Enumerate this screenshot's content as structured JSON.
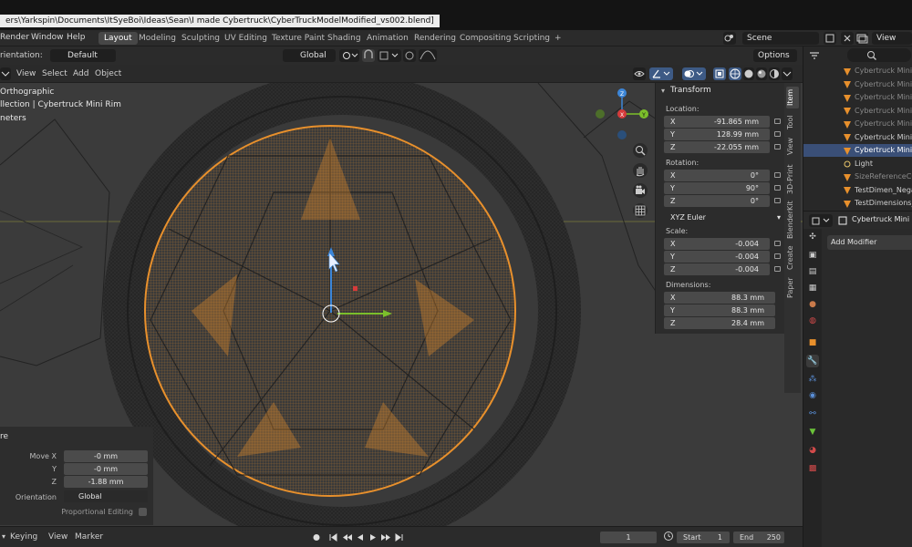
{
  "window": {
    "title": "ers\\Yarkspin\\Documents\\ItSyeBoi\\Ideas\\Sean\\I made  Cybertruck\\CyberTruckModelModified_vs002.blend]"
  },
  "menu": [
    "Render",
    "Window",
    "Help"
  ],
  "workspaces": {
    "tabs": [
      "Layout",
      "Modeling",
      "Sculpting",
      "UV Editing",
      "Texture Paint",
      "Shading",
      "Animation",
      "Rendering",
      "Compositing",
      "Scripting"
    ],
    "active": "Layout",
    "add": "+"
  },
  "scene": {
    "label": "Scene",
    "view_layer": "View Laye"
  },
  "header2": {
    "orientation_label": "rientation:",
    "orientation_value": "Default",
    "transform_orientation": "Global",
    "options_label": "Options"
  },
  "header3": {
    "menus": [
      "View",
      "Select",
      "Add",
      "Object"
    ]
  },
  "viewport": {
    "overlay": [
      "Orthographic",
      "llection | Cybertruck Mini Rim",
      "neters"
    ],
    "gizmo": {
      "x": "X",
      "y": "Y",
      "z": "Z"
    }
  },
  "npanel": {
    "tabs": [
      "Item",
      "Tool",
      "View",
      "3D-Print",
      "BlenderKit",
      "Create",
      "Paper"
    ],
    "active_tab": "Item",
    "section": "Transform",
    "location_label": "Location:",
    "location": [
      {
        "axis": "X",
        "value": "-91.865 mm"
      },
      {
        "axis": "Y",
        "value": "128.99 mm"
      },
      {
        "axis": "Z",
        "value": "-22.055 mm"
      }
    ],
    "rotation_label": "Rotation:",
    "rotation": [
      {
        "axis": "X",
        "value": "0°"
      },
      {
        "axis": "Y",
        "value": "90°"
      },
      {
        "axis": "Z",
        "value": "0°"
      }
    ],
    "rotation_mode": "XYZ Euler",
    "scale_label": "Scale:",
    "scale": [
      {
        "axis": "X",
        "value": "-0.004"
      },
      {
        "axis": "Y",
        "value": "-0.004"
      },
      {
        "axis": "Z",
        "value": "-0.004"
      }
    ],
    "dimensions_label": "Dimensions:",
    "dimensions": [
      {
        "axis": "X",
        "value": "88.3 mm"
      },
      {
        "axis": "Y",
        "value": "88.3 mm"
      },
      {
        "axis": "Z",
        "value": "28.4 mm"
      }
    ]
  },
  "redo_panel": {
    "title": "re",
    "fields": [
      {
        "label": "Move X",
        "value": "-0 mm"
      },
      {
        "label": "Y",
        "value": "-0 mm"
      },
      {
        "label": "Z",
        "value": "-1.88 mm"
      }
    ],
    "orientation_label": "Orientation",
    "orientation_value": "Global",
    "proportional_label": "Proportional Editing"
  },
  "timeline": {
    "menus": [
      "Keying",
      "View",
      "Marker"
    ],
    "current_frame": "1",
    "start_label": "Start",
    "start": "1",
    "end_label": "End",
    "end": "250"
  },
  "outliner": {
    "items": [
      {
        "name": "Cybertruck Mini R",
        "style": "dim"
      },
      {
        "name": "Cybertruck Mini F",
        "style": "dim"
      },
      {
        "name": "Cybertruck Mini F",
        "style": "dim"
      },
      {
        "name": "Cybertruck Mini F",
        "style": "dim"
      },
      {
        "name": "Cybertruck Mini F",
        "style": "dim"
      },
      {
        "name": "Cybertruck Mini F",
        "style": "normal"
      },
      {
        "name": "Cybertruck Mini R",
        "style": "sel"
      },
      {
        "name": "Light",
        "style": "normal"
      },
      {
        "name": "SizeReferenceCu",
        "style": "dim"
      },
      {
        "name": "TestDimen_Nega",
        "style": "normal"
      },
      {
        "name": "TestDimensions_",
        "style": "normal"
      }
    ]
  },
  "properties": {
    "object_name": "Cybertruck Mini Ri",
    "add_modifier": "Add Modifier"
  },
  "colors": {
    "selection_orange": "#e8902c",
    "viewport_bg": "#3b3b3b",
    "outliner_selected": "#3a4f77",
    "gizmo_x": "#d63b3b",
    "gizmo_y": "#7cbf2b",
    "gizmo_z": "#3c86d8"
  }
}
